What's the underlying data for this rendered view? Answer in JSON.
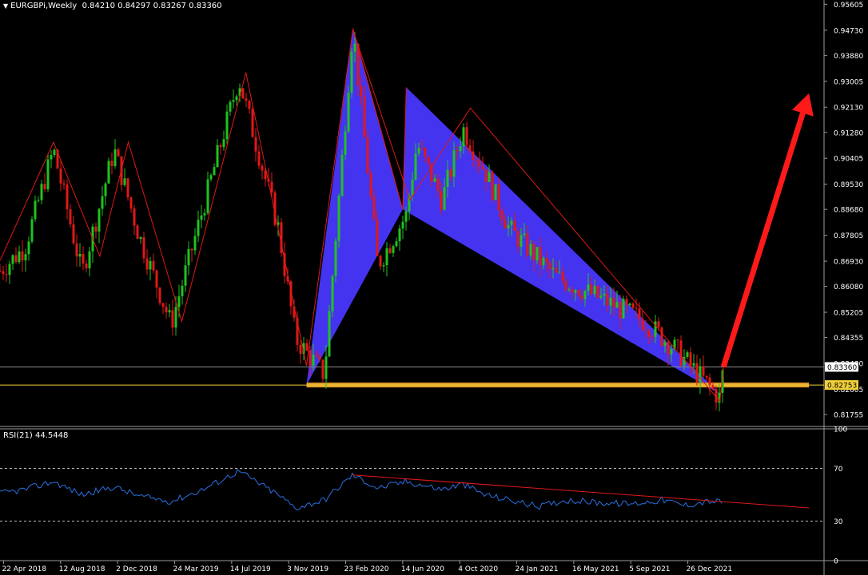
{
  "header": {
    "symbol_line": "EURGBPi,Weekly",
    "ohlc": "0.84210 0.84297 0.83267 0.83360"
  },
  "price_axis": {
    "ticks": [
      "0.95605",
      "0.94730",
      "0.93880",
      "0.93005",
      "0.92130",
      "0.91280",
      "0.90405",
      "0.89530",
      "0.88680",
      "0.87805",
      "0.86930",
      "0.86080",
      "0.85205",
      "0.84355",
      "0.83480",
      "0.82605",
      "0.81755"
    ],
    "current_price_label": "0.83360",
    "support_price_label": "0.82753"
  },
  "date_axis": {
    "ticks": [
      "22 Apr 2018",
      "12 Aug 2018",
      "2 Dec 2018",
      "24 Mar 2019",
      "14 Jul 2019",
      "3 Nov 2019",
      "23 Feb 2020",
      "14 Jun 2020",
      "4 Oct 2020",
      "24 Jan 2021",
      "16 May 2021",
      "5 Sep 2021",
      "26 Dec 2021"
    ]
  },
  "rsi": {
    "title": "RSI(21) 44.5448",
    "ticks": [
      "100",
      "70",
      "30",
      "0"
    ],
    "levels": [
      70,
      30
    ]
  },
  "colors": {
    "background": "#000000",
    "candle_bull": "#1fc21f",
    "candle_bear": "#e01818",
    "zigzag": "#e01818",
    "harmonic_fill": "#4434f0",
    "support": "#e6a22e",
    "rsi_line": "#2a6fe0",
    "rsi_trend": "#e01818",
    "arrow": "#ff1a1a",
    "price_line": "#8a8a8a",
    "axis_text": "#ffffff",
    "price_box": "#ffffff",
    "support_box": "#f0d038"
  },
  "chart_data": {
    "type": "candlestick",
    "title": "EURGBPi,Weekly",
    "x_range": [
      "2018-04-15",
      "2022-09-18"
    ],
    "ylim": [
      0.8135,
      0.9575
    ],
    "price_path": [
      [
        "2018-04-15",
        0.866
      ],
      [
        "2018-06-03",
        0.874
      ],
      [
        "2018-07-29",
        0.907
      ],
      [
        "2018-09-23",
        0.865
      ],
      [
        "2018-11-25",
        0.907
      ],
      [
        "2019-01-13",
        0.878
      ],
      [
        "2019-03-17",
        0.848
      ],
      [
        "2019-07-28",
        0.931
      ],
      [
        "2019-10-13",
        0.881
      ],
      [
        "2019-11-17",
        0.843
      ],
      [
        "2020-01-12",
        0.831
      ],
      [
        "2020-03-08",
        0.948
      ],
      [
        "2020-04-26",
        0.868
      ],
      [
        "2020-06-21",
        0.885
      ],
      [
        "2020-07-12",
        0.909
      ],
      [
        "2020-08-30",
        0.89
      ],
      [
        "2020-10-11",
        0.914
      ],
      [
        "2020-11-22",
        0.9
      ],
      [
        "2021-01-10",
        0.88
      ],
      [
        "2021-04-11",
        0.864
      ],
      [
        "2021-07-04",
        0.857
      ],
      [
        "2021-10-03",
        0.849
      ],
      [
        "2021-12-05",
        0.839
      ],
      [
        "2022-02-27",
        0.823
      ],
      [
        "2022-03-06",
        0.8336
      ]
    ],
    "harmonic_pattern": {
      "points": [
        [
          "2019-12-08",
          0.8275
        ],
        [
          "2020-03-08",
          0.948
        ],
        [
          "2020-06-14",
          0.8868
        ],
        [
          "2020-06-21",
          0.928
        ],
        [
          "2022-02-27",
          0.8245
        ]
      ]
    },
    "zigzag": [
      [
        "2018-04-15",
        0.8695
      ],
      [
        "2018-07-29",
        0.9095
      ],
      [
        "2018-10-28",
        0.871
      ],
      [
        "2018-12-23",
        0.9095
      ],
      [
        "2019-04-07",
        0.849
      ],
      [
        "2019-08-11",
        0.933
      ],
      [
        "2019-12-08",
        0.834
      ],
      [
        "2020-03-08",
        0.9475
      ],
      [
        "2020-06-28",
        0.89
      ],
      [
        "2020-10-25",
        0.921
      ],
      [
        "2022-02-27",
        0.822
      ],
      [
        "2022-03-06",
        0.8335
      ]
    ],
    "support": {
      "value": 0.8275,
      "x_start": "2019-12-08",
      "x_end": "2022-08-21"
    },
    "current_price": 0.8336,
    "projection_arrow": {
      "from": [
        "2022-03-06",
        0.8336
      ],
      "to": [
        "2022-08-21",
        0.926
      ]
    },
    "rsi": {
      "period": 21,
      "value": 44.5448,
      "ylim": [
        0,
        100
      ],
      "levels": [
        70,
        30
      ],
      "path": [
        [
          "2018-04-15",
          51
        ],
        [
          "2018-06-03",
          54
        ],
        [
          "2018-07-29",
          60
        ],
        [
          "2018-09-23",
          50
        ],
        [
          "2018-11-25",
          56
        ],
        [
          "2019-01-13",
          49
        ],
        [
          "2019-03-17",
          45
        ],
        [
          "2019-05-19",
          54
        ],
        [
          "2019-07-28",
          68
        ],
        [
          "2019-10-13",
          50
        ],
        [
          "2019-11-17",
          40
        ],
        [
          "2020-01-12",
          46
        ],
        [
          "2020-03-08",
          65
        ],
        [
          "2020-04-26",
          55
        ],
        [
          "2020-06-21",
          60
        ],
        [
          "2020-08-30",
          54
        ],
        [
          "2020-10-11",
          58
        ],
        [
          "2020-11-22",
          50
        ],
        [
          "2021-01-10",
          46
        ],
        [
          "2021-03-07",
          41
        ],
        [
          "2021-05-02",
          46
        ],
        [
          "2021-07-04",
          44
        ],
        [
          "2021-09-05",
          43
        ],
        [
          "2021-11-07",
          46
        ],
        [
          "2021-12-19",
          42
        ],
        [
          "2022-02-06",
          45
        ],
        [
          "2022-03-06",
          44.5
        ]
      ],
      "trendline": [
        [
          "2020-03-08",
          65
        ],
        [
          "2022-08-21",
          40
        ]
      ]
    }
  }
}
